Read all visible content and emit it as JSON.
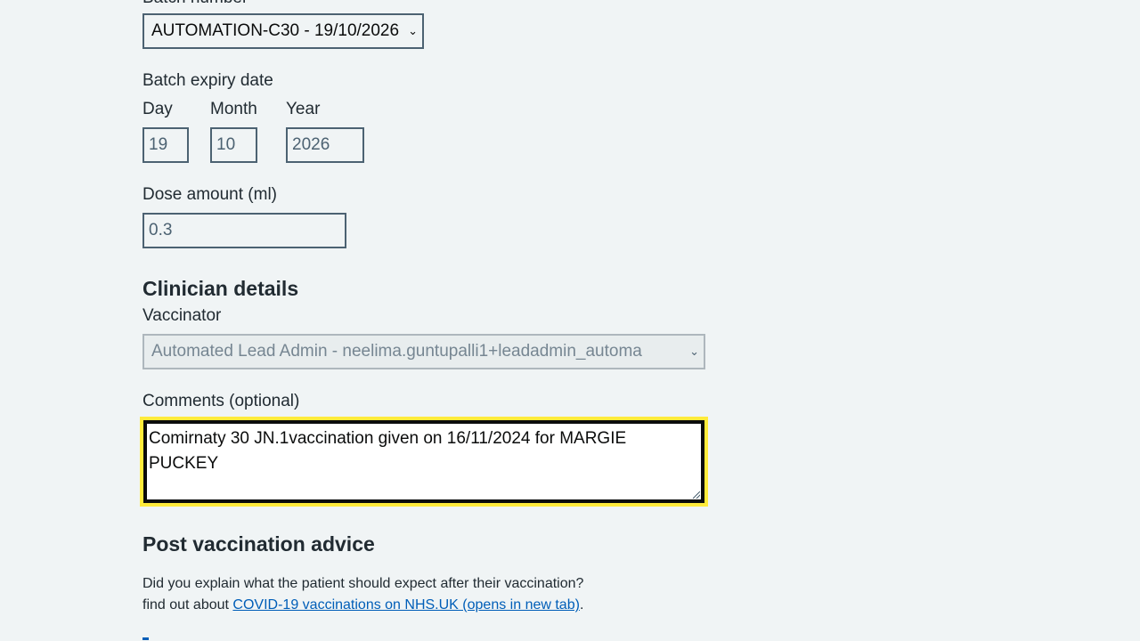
{
  "batch": {
    "label": "Batch number",
    "selected": "AUTOMATION-C30 - 19/10/2026"
  },
  "expiry": {
    "label": "Batch expiry date",
    "day_label": "Day",
    "month_label": "Month",
    "year_label": "Year",
    "day": "19",
    "month": "10",
    "year": "2026"
  },
  "dose": {
    "label": "Dose amount (ml)",
    "value": "0.3"
  },
  "clinician": {
    "heading": "Clinician details",
    "vaccinator_label": "Vaccinator",
    "vaccinator_selected": "Automated Lead Admin - neelima.guntupalli1+leadadmin_automa"
  },
  "comments": {
    "label": "Comments (optional)",
    "value": "Comirnaty 30 JN.1vaccination given on 16/11/2024 for MARGIE PUCKEY"
  },
  "advice": {
    "heading": "Post vaccination advice",
    "line1": "Did you explain what the patient should expect after their vaccination?",
    "line2_prefix": "find out about ",
    "link_text": "COVID-19 vaccinations on NHS.UK (opens in new tab)",
    "line2_suffix": "."
  },
  "icons": {
    "select_chevron": "chevron-down-icon"
  }
}
